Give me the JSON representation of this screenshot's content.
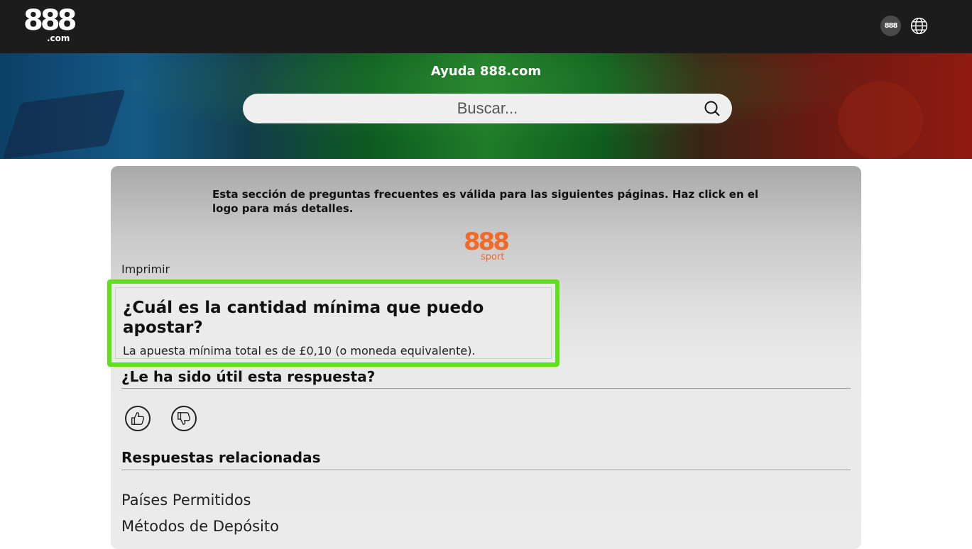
{
  "header": {
    "logo_text": "888",
    "logo_suffix": ".com",
    "brand_badge": "888",
    "icons": [
      "888-badge-icon",
      "globe-icon"
    ]
  },
  "hero": {
    "title": "Ayuda 888.com",
    "search_placeholder": "Buscar...",
    "search_icon": "search-icon"
  },
  "faq": {
    "notice": "Esta sección de preguntas frecuentes es válida para las siguientes páginas. Haz click en el logo para más detalles.",
    "sport_logo_num": "888",
    "sport_logo_text": "sport",
    "print_label": "Imprimir",
    "question": "¿Cuál es la cantidad mínima que puedo apostar?",
    "answer": "La apuesta mínima total es de £0,10 (o moneda equivalente).",
    "highlight_color": "#5ee01a"
  },
  "feedback": {
    "heading": "¿Le ha sido útil esta respuesta?",
    "icons": [
      "thumbs-up-icon",
      "thumbs-down-icon"
    ]
  },
  "related": {
    "heading": "Respuestas relacionadas",
    "items": [
      {
        "label": "Países Permitidos"
      },
      {
        "label": "Métodos de Depósito"
      }
    ]
  },
  "colors": {
    "topbar": "#1c1c1c",
    "accent_orange": "#f06a2a"
  }
}
